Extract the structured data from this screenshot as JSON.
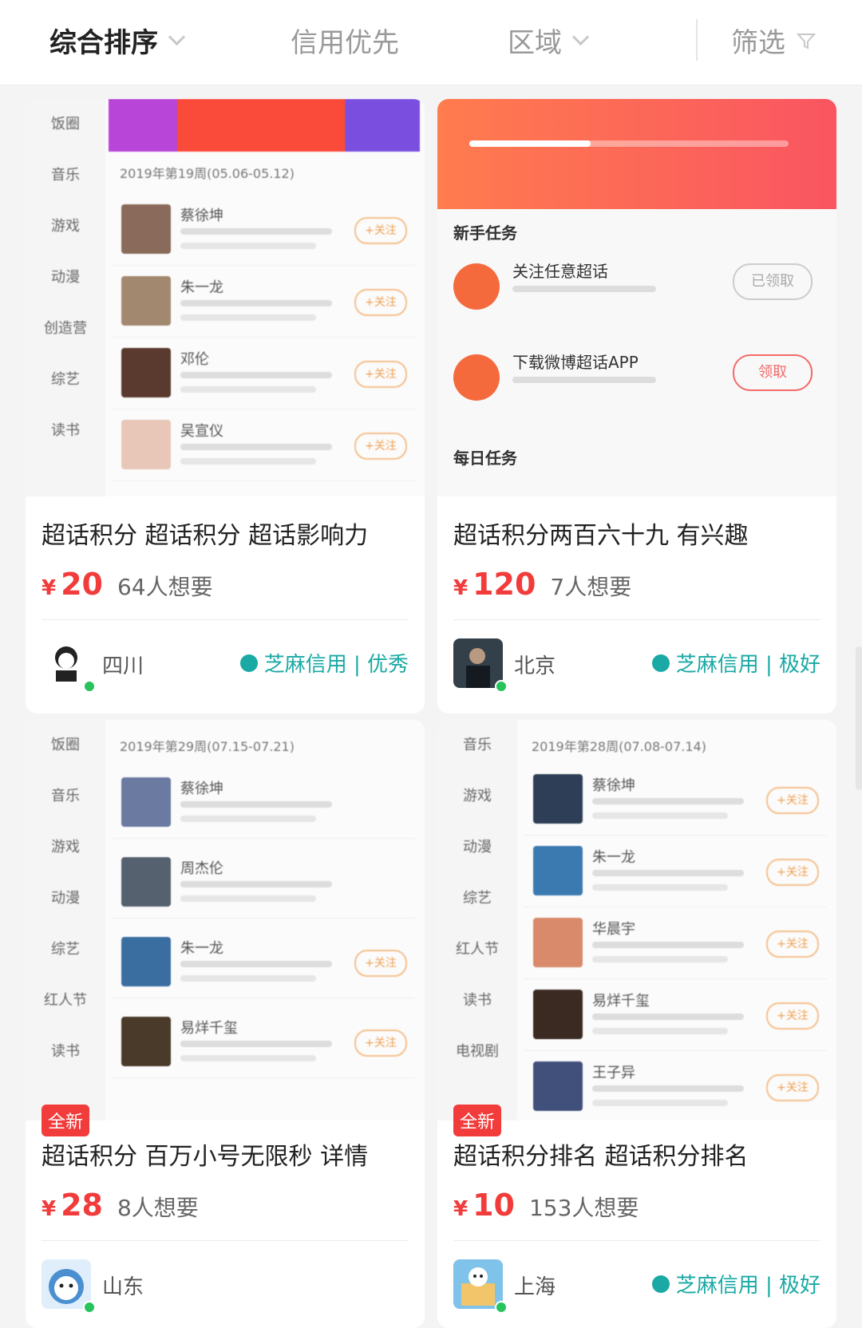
{
  "filters": [
    {
      "label": "综合排序",
      "active": true,
      "icon": "chevron-down-icon"
    },
    {
      "label": "信用优先",
      "active": false
    },
    {
      "label": "区域",
      "active": false,
      "icon": "chevron-down-icon"
    },
    {
      "label": "筛选",
      "active": false,
      "icon": "filter-funnel-icon"
    }
  ],
  "cards": [
    {
      "title": "超话积分 超话积分 超话影响力",
      "currency": "¥",
      "price": "20",
      "want": "64人想要",
      "region": "四川",
      "credit": "芝麻信用 | 优秀",
      "is_new": false
    },
    {
      "title": "超话积分两百六十九 有兴趣",
      "currency": "¥",
      "price": "120",
      "want": "7人想要",
      "region": "北京",
      "credit": "芝麻信用 | 极好",
      "is_new": false
    },
    {
      "title": "超话积分 百万小号无限秒 详情",
      "currency": "¥",
      "price": "28",
      "want": "8人想要",
      "region": "山东",
      "credit": "",
      "is_new": true,
      "badge": "全新"
    },
    {
      "title": "超话积分排名 超话积分排名",
      "currency": "¥",
      "price": "10",
      "want": "153人想要",
      "region": "上海",
      "credit": "芝麻信用 | 极好",
      "is_new": true,
      "badge": "全新"
    }
  ],
  "thumb1": {
    "side": [
      "饭圈",
      "音乐",
      "游戏",
      "动漫",
      "创造营",
      "综艺",
      "读书"
    ],
    "week": "2019年第19周(05.06-05.12)",
    "rows": [
      "蔡徐坤",
      "朱一龙",
      "邓伦",
      "吴宣仪"
    ],
    "follow": "+关注"
  },
  "thumb2": {
    "section1": "新手任务",
    "task1": "关注任意超话",
    "task1_btn": "已领取",
    "task2": "下载微博超话APP",
    "task2_btn": "领取",
    "section2": "每日任务",
    "progress": 0.38
  },
  "thumb3": {
    "side": [
      "饭圈",
      "音乐",
      "游戏",
      "动漫",
      "综艺",
      "红人节",
      "读书"
    ],
    "week": "2019年第29周(07.15-07.21)",
    "rows": [
      "蔡徐坤",
      "周杰伦",
      "朱一龙",
      "易烊千玺"
    ],
    "follow": "+关注"
  },
  "thumb4": {
    "side": [
      "音乐",
      "游戏",
      "动漫",
      "综艺",
      "红人节",
      "读书",
      "电视剧"
    ],
    "week": "2019年第28周(07.08-07.14)",
    "rows": [
      "蔡徐坤",
      "朱一龙",
      "华晨宇",
      "易烊千玺",
      "王子异"
    ],
    "follow": "+关注"
  }
}
